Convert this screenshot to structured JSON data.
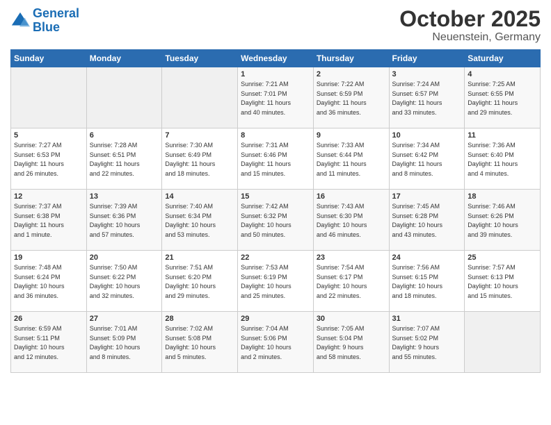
{
  "logo": {
    "line1": "General",
    "line2": "Blue"
  },
  "title": "October 2025",
  "location": "Neuenstein, Germany",
  "days_header": [
    "Sunday",
    "Monday",
    "Tuesday",
    "Wednesday",
    "Thursday",
    "Friday",
    "Saturday"
  ],
  "weeks": [
    [
      {
        "day": "",
        "info": ""
      },
      {
        "day": "",
        "info": ""
      },
      {
        "day": "",
        "info": ""
      },
      {
        "day": "1",
        "info": "Sunrise: 7:21 AM\nSunset: 7:01 PM\nDaylight: 11 hours\nand 40 minutes."
      },
      {
        "day": "2",
        "info": "Sunrise: 7:22 AM\nSunset: 6:59 PM\nDaylight: 11 hours\nand 36 minutes."
      },
      {
        "day": "3",
        "info": "Sunrise: 7:24 AM\nSunset: 6:57 PM\nDaylight: 11 hours\nand 33 minutes."
      },
      {
        "day": "4",
        "info": "Sunrise: 7:25 AM\nSunset: 6:55 PM\nDaylight: 11 hours\nand 29 minutes."
      }
    ],
    [
      {
        "day": "5",
        "info": "Sunrise: 7:27 AM\nSunset: 6:53 PM\nDaylight: 11 hours\nand 26 minutes."
      },
      {
        "day": "6",
        "info": "Sunrise: 7:28 AM\nSunset: 6:51 PM\nDaylight: 11 hours\nand 22 minutes."
      },
      {
        "day": "7",
        "info": "Sunrise: 7:30 AM\nSunset: 6:49 PM\nDaylight: 11 hours\nand 18 minutes."
      },
      {
        "day": "8",
        "info": "Sunrise: 7:31 AM\nSunset: 6:46 PM\nDaylight: 11 hours\nand 15 minutes."
      },
      {
        "day": "9",
        "info": "Sunrise: 7:33 AM\nSunset: 6:44 PM\nDaylight: 11 hours\nand 11 minutes."
      },
      {
        "day": "10",
        "info": "Sunrise: 7:34 AM\nSunset: 6:42 PM\nDaylight: 11 hours\nand 8 minutes."
      },
      {
        "day": "11",
        "info": "Sunrise: 7:36 AM\nSunset: 6:40 PM\nDaylight: 11 hours\nand 4 minutes."
      }
    ],
    [
      {
        "day": "12",
        "info": "Sunrise: 7:37 AM\nSunset: 6:38 PM\nDaylight: 11 hours\nand 1 minute."
      },
      {
        "day": "13",
        "info": "Sunrise: 7:39 AM\nSunset: 6:36 PM\nDaylight: 10 hours\nand 57 minutes."
      },
      {
        "day": "14",
        "info": "Sunrise: 7:40 AM\nSunset: 6:34 PM\nDaylight: 10 hours\nand 53 minutes."
      },
      {
        "day": "15",
        "info": "Sunrise: 7:42 AM\nSunset: 6:32 PM\nDaylight: 10 hours\nand 50 minutes."
      },
      {
        "day": "16",
        "info": "Sunrise: 7:43 AM\nSunset: 6:30 PM\nDaylight: 10 hours\nand 46 minutes."
      },
      {
        "day": "17",
        "info": "Sunrise: 7:45 AM\nSunset: 6:28 PM\nDaylight: 10 hours\nand 43 minutes."
      },
      {
        "day": "18",
        "info": "Sunrise: 7:46 AM\nSunset: 6:26 PM\nDaylight: 10 hours\nand 39 minutes."
      }
    ],
    [
      {
        "day": "19",
        "info": "Sunrise: 7:48 AM\nSunset: 6:24 PM\nDaylight: 10 hours\nand 36 minutes."
      },
      {
        "day": "20",
        "info": "Sunrise: 7:50 AM\nSunset: 6:22 PM\nDaylight: 10 hours\nand 32 minutes."
      },
      {
        "day": "21",
        "info": "Sunrise: 7:51 AM\nSunset: 6:20 PM\nDaylight: 10 hours\nand 29 minutes."
      },
      {
        "day": "22",
        "info": "Sunrise: 7:53 AM\nSunset: 6:19 PM\nDaylight: 10 hours\nand 25 minutes."
      },
      {
        "day": "23",
        "info": "Sunrise: 7:54 AM\nSunset: 6:17 PM\nDaylight: 10 hours\nand 22 minutes."
      },
      {
        "day": "24",
        "info": "Sunrise: 7:56 AM\nSunset: 6:15 PM\nDaylight: 10 hours\nand 18 minutes."
      },
      {
        "day": "25",
        "info": "Sunrise: 7:57 AM\nSunset: 6:13 PM\nDaylight: 10 hours\nand 15 minutes."
      }
    ],
    [
      {
        "day": "26",
        "info": "Sunrise: 6:59 AM\nSunset: 5:11 PM\nDaylight: 10 hours\nand 12 minutes."
      },
      {
        "day": "27",
        "info": "Sunrise: 7:01 AM\nSunset: 5:09 PM\nDaylight: 10 hours\nand 8 minutes."
      },
      {
        "day": "28",
        "info": "Sunrise: 7:02 AM\nSunset: 5:08 PM\nDaylight: 10 hours\nand 5 minutes."
      },
      {
        "day": "29",
        "info": "Sunrise: 7:04 AM\nSunset: 5:06 PM\nDaylight: 10 hours\nand 2 minutes."
      },
      {
        "day": "30",
        "info": "Sunrise: 7:05 AM\nSunset: 5:04 PM\nDaylight: 9 hours\nand 58 minutes."
      },
      {
        "day": "31",
        "info": "Sunrise: 7:07 AM\nSunset: 5:02 PM\nDaylight: 9 hours\nand 55 minutes."
      },
      {
        "day": "",
        "info": ""
      }
    ]
  ]
}
